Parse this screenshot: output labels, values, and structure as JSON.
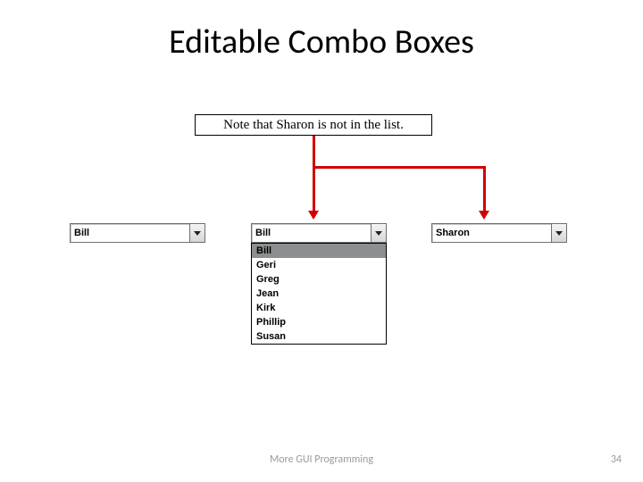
{
  "title": "Editable Combo Boxes",
  "callout": "Note that Sharon is not in the list.",
  "combos": {
    "combo1": {
      "value": "Bill"
    },
    "combo2": {
      "value": "Bill"
    },
    "combo3": {
      "value": "Sharon"
    }
  },
  "dropdown": {
    "items": [
      "Bill",
      "Geri",
      "Greg",
      "Jean",
      "Kirk",
      "Phillip",
      "Susan"
    ],
    "selected_index": 0
  },
  "footer": "More GUI Programming",
  "page": "34"
}
